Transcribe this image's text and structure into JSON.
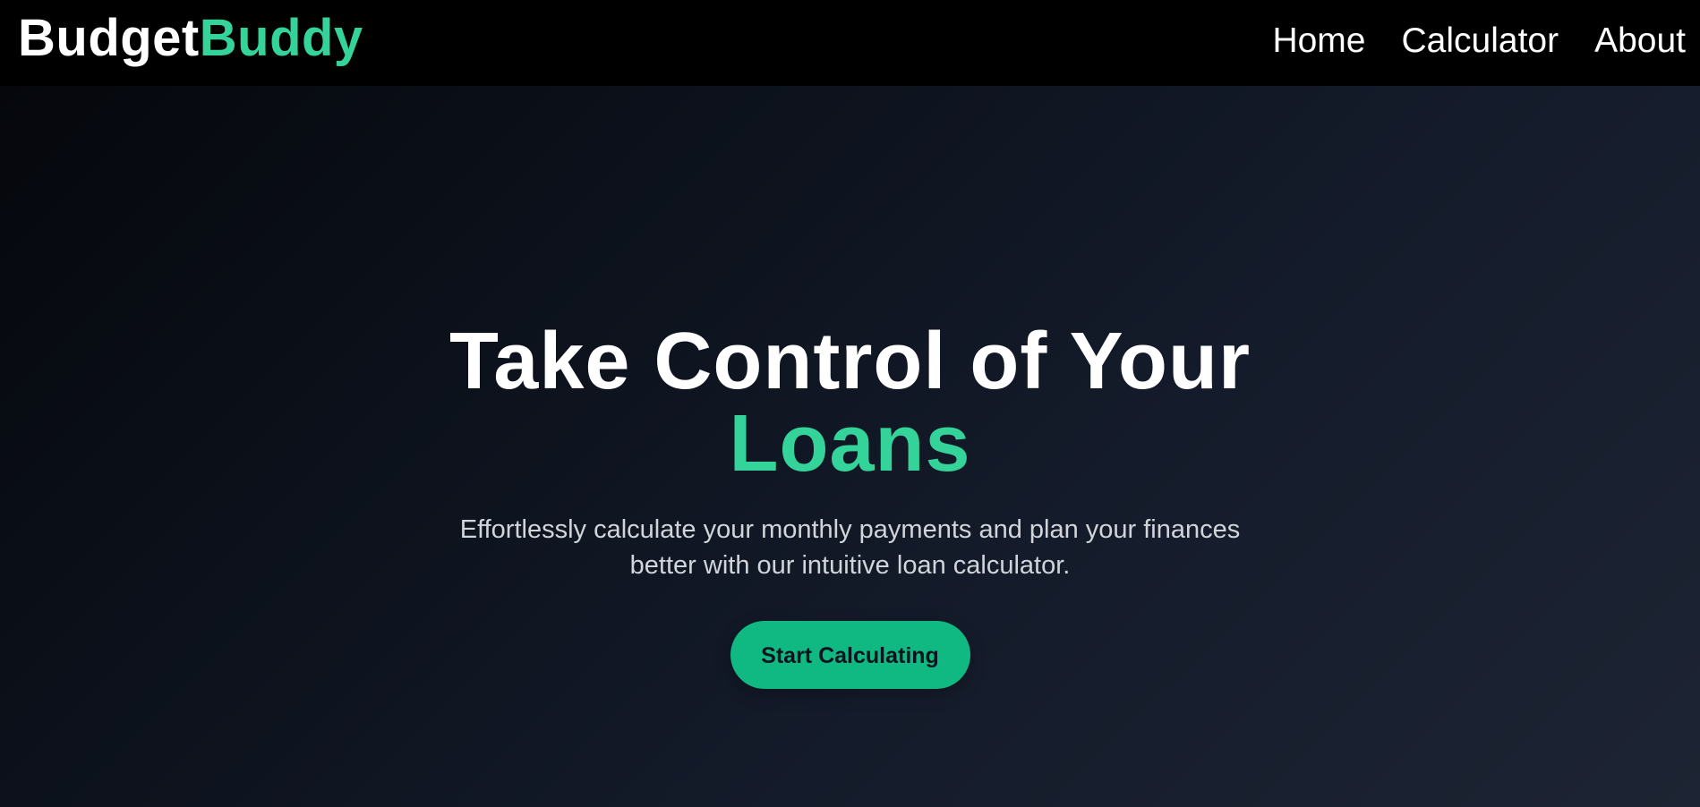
{
  "header": {
    "brand": {
      "part1": "Budget",
      "part2": "Buddy"
    },
    "nav": [
      {
        "label": "Home"
      },
      {
        "label": "Calculator"
      },
      {
        "label": "About"
      }
    ]
  },
  "hero": {
    "title_line1": "Take Control of Your",
    "title_accent": "Loans",
    "subtitle_line1": "Effortlessly calculate your monthly payments and plan your finances",
    "subtitle_line2": "better with our intuitive loan calculator.",
    "cta_label": "Start Calculating"
  },
  "colors": {
    "accent": "#34d399",
    "button": "#10b981",
    "text": "#ffffff",
    "muted_text": "#d1d5db",
    "topbar": "#000000",
    "hero_bg_dark": "#05070c",
    "hero_bg_light": "#1d2433"
  }
}
